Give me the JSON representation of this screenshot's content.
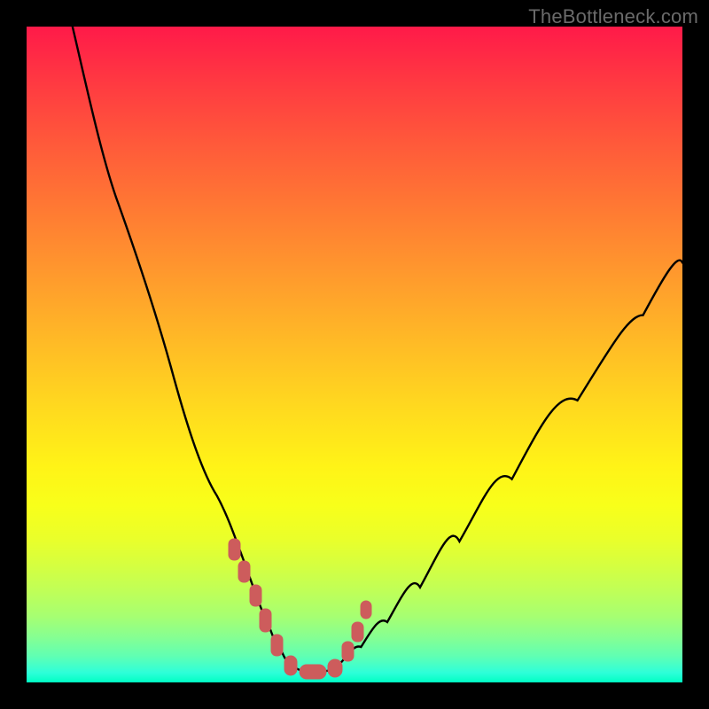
{
  "watermark": "TheBottleneck.com",
  "chart_data": {
    "type": "line",
    "title": "",
    "xlabel": "",
    "ylabel": "",
    "xlim": [
      0,
      100
    ],
    "ylim": [
      0,
      100
    ],
    "grid": false,
    "series": [
      {
        "name": "curve",
        "x": [
          7,
          10,
          14,
          18,
          22,
          26,
          29,
          31.5,
          33.5,
          35.5,
          37,
          38.5,
          40,
          42,
          44,
          46,
          48,
          51,
          55,
          60,
          66,
          74,
          84,
          94,
          100
        ],
        "y": [
          100,
          88,
          73,
          60,
          48,
          37,
          28.5,
          22.5,
          17.5,
          12.5,
          8.5,
          5.6,
          3.4,
          1.9,
          1.4,
          1.8,
          3.1,
          5.4,
          9.2,
          14.5,
          21.5,
          31,
          43,
          56,
          64
        ]
      }
    ],
    "markers": {
      "name": "marker-cluster",
      "approx_count": 11,
      "center_x_range": [
        31,
        49
      ],
      "y_at_center_range": [
        0.5,
        17
      ],
      "color": "#cd5c5c",
      "shape": "rounded"
    }
  }
}
